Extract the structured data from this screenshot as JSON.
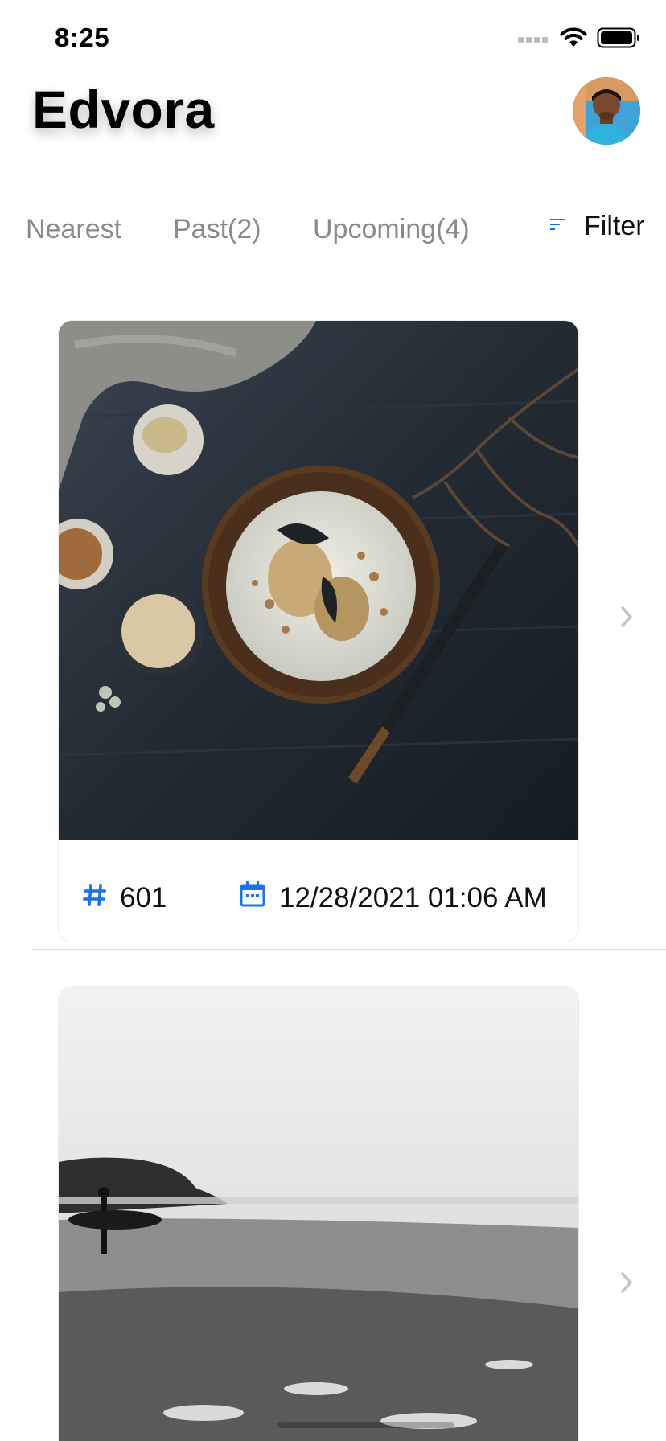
{
  "status_bar": {
    "time": "8:25"
  },
  "header": {
    "title": "Edvora"
  },
  "tabs": [
    {
      "label": "Nearest"
    },
    {
      "label": "Past(2)"
    },
    {
      "label": "Upcoming(4)"
    }
  ],
  "filter": {
    "label": "Filter",
    "icon": "filter-lines-icon"
  },
  "cards": [
    {
      "id": "601",
      "date": "12/28/2021 01:06 AM",
      "image": "food-dessert-on-dark-wood-photo"
    },
    {
      "image": "black-and-white-beach-surfer-photo"
    }
  ],
  "colors": {
    "accent": "#1a73e8",
    "tab_text": "#8a8a8e",
    "chevron": "#c4c4c7"
  }
}
